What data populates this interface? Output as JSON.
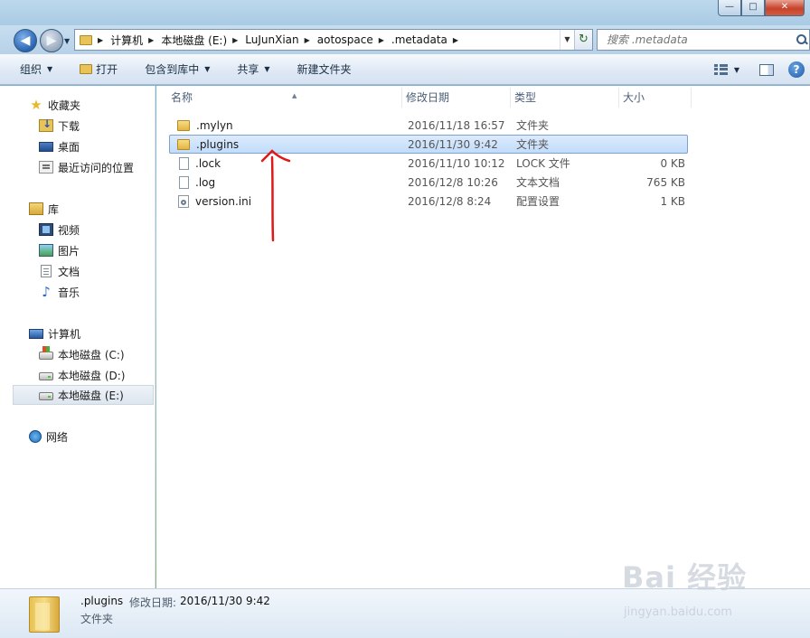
{
  "window": {
    "buttons": {
      "minimize": "—",
      "maximize": "□",
      "close": "✕"
    }
  },
  "address": {
    "crumbs": [
      "计算机",
      "本地磁盘 (E:)",
      "LuJunXian",
      "aotospace",
      ".metadata"
    ],
    "search_placeholder": "搜索 .metadata"
  },
  "toolbar": {
    "organize": "组织",
    "open": "打开",
    "include_library": "包含到库中",
    "share": "共享",
    "new_folder": "新建文件夹"
  },
  "navpane": {
    "favorites": "收藏夹",
    "downloads": "下载",
    "desktop": "桌面",
    "recent": "最近访问的位置",
    "libraries": "库",
    "videos": "视频",
    "pictures": "图片",
    "documents": "文档",
    "music": "音乐",
    "computer": "计算机",
    "drive_c": "本地磁盘 (C:)",
    "drive_d": "本地磁盘 (D:)",
    "drive_e": "本地磁盘 (E:)",
    "network": "网络"
  },
  "columns": {
    "name": "名称",
    "date": "修改日期",
    "type": "类型",
    "size": "大小"
  },
  "files": [
    {
      "name": ".mylyn",
      "date": "2016/11/18 16:57",
      "type": "文件夹",
      "size": "",
      "icon": "folder-icon"
    },
    {
      "name": ".plugins",
      "date": "2016/11/30 9:42",
      "type": "文件夹",
      "size": "",
      "icon": "folder-icon",
      "selected": true
    },
    {
      "name": ".lock",
      "date": "2016/11/10 10:12",
      "type": "LOCK 文件",
      "size": "0 KB",
      "icon": "file-icon"
    },
    {
      "name": ".log",
      "date": "2016/12/8 10:26",
      "type": "文本文档",
      "size": "765 KB",
      "icon": "file-icon"
    },
    {
      "name": "version.ini",
      "date": "2016/12/8 8:24",
      "type": "配置设置",
      "size": "1 KB",
      "icon": "settings-file-icon"
    }
  ],
  "details": {
    "name": ".plugins",
    "modified_label": "修改日期:",
    "modified": "2016/11/30 9:42",
    "type": "文件夹"
  },
  "watermark": {
    "text": "Bai 经验",
    "sub": "jingyan.baidu.com"
  },
  "colors": {
    "selection": "#c1dcfb",
    "annotation": "#e01818"
  }
}
